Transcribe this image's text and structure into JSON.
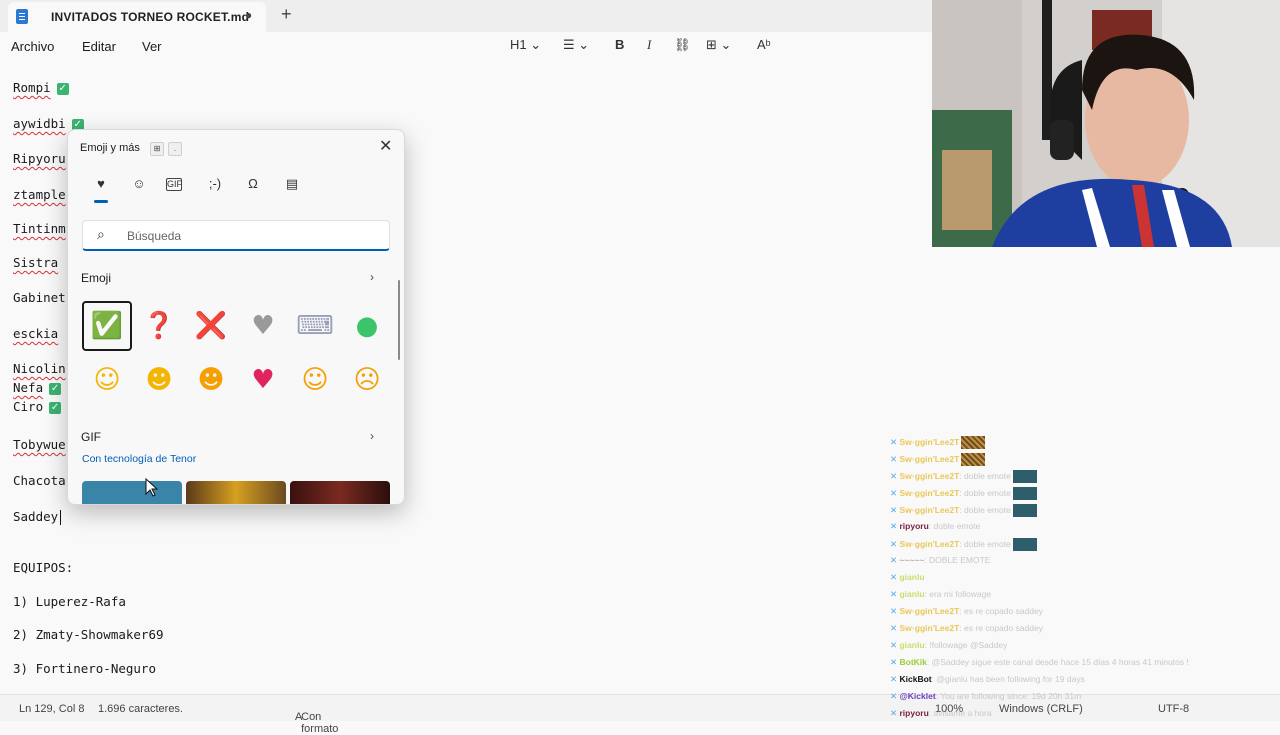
{
  "window": {
    "tab_title": "INVITADOS TORNEO ROCKET.md",
    "unsaved_indicator": "●",
    "new_tab": "+"
  },
  "menu": {
    "archivo": "Archivo",
    "editar": "Editar",
    "ver": "Ver"
  },
  "toolbar": {
    "heading": "H1",
    "bold": "B",
    "italic": "I"
  },
  "editor": {
    "lines": [
      {
        "text": "Rompi",
        "check": true
      },
      {
        "text": "aywidbi",
        "check": true
      },
      {
        "text": "Ripyoru",
        "check": false
      },
      {
        "text": "ztample",
        "check": false
      },
      {
        "text": "Tintinm",
        "check": false
      },
      {
        "text": "Sistra",
        "check": false
      },
      {
        "text": "Gabinet",
        "check": false
      },
      {
        "text": "esckia",
        "check": false
      },
      {
        "text": "Nicolin",
        "check": false
      },
      {
        "text": "Nefa",
        "check": true
      },
      {
        "text": "Ciro",
        "check": true
      },
      {
        "text": "Tobywue",
        "check": false
      },
      {
        "text": "Chacota",
        "check": false
      },
      {
        "text": "Saddey",
        "check": false
      },
      {
        "text": "EQUIPOS:",
        "check": false
      },
      {
        "text": "1) Luperez-Rafa",
        "check": false
      },
      {
        "text": "2) Zmaty-Showmaker69",
        "check": false
      },
      {
        "text": "3) Fortinero-Neguro",
        "check": false
      }
    ],
    "check_glyph": "✓"
  },
  "status_bar": {
    "position": "Ln 129, Col 8",
    "characters": "1.696 caracteres.",
    "format": "Con formato",
    "zoom": "100%",
    "line_endings": "Windows (CRLF)",
    "encoding": "UTF-8"
  },
  "emoji_panel": {
    "title": "Emoji y más",
    "close": "✕",
    "categories": [
      {
        "name": "favorites",
        "glyph": "♥"
      },
      {
        "name": "emoji",
        "glyph": "☺"
      },
      {
        "name": "gif",
        "glyph": "GIF"
      },
      {
        "name": "kaomoji",
        "glyph": ";-)"
      },
      {
        "name": "symbols",
        "glyph": "Ω"
      },
      {
        "name": "clipboard",
        "glyph": "▤"
      }
    ],
    "search_placeholder": "Búsqueda",
    "emoji_section": "Emoji",
    "gif_section": "GIF",
    "tenor_credit": "Con tecnología de Tenor",
    "emojis": [
      {
        "glyph": "✅",
        "color": "#3cb371",
        "selected": true
      },
      {
        "glyph": "❓",
        "color": "#d6336c"
      },
      {
        "glyph": "❌",
        "color": "#d6336c"
      },
      {
        "glyph": "♥",
        "color": "#9a9a9a"
      },
      {
        "glyph": "⌨",
        "color": "#9aa0b8"
      },
      {
        "glyph": "●",
        "color": "#3cc46a"
      },
      {
        "glyph": "☺",
        "color": "#f4b400"
      },
      {
        "glyph": "☻",
        "color": "#f4b400"
      },
      {
        "glyph": "☻",
        "color": "#f59f00"
      },
      {
        "glyph": "♥",
        "color": "#e0245e"
      },
      {
        "glyph": "☺",
        "color": "#f59f00"
      },
      {
        "glyph": "☹",
        "color": "#f59f00"
      }
    ]
  },
  "chat": {
    "lines": [
      {
        "user": "Sw◦ggin'Lee2T",
        "msg": "",
        "emote": "leo",
        "user_color": "#e8c85a"
      },
      {
        "user": "Sw◦ggin'Lee2T",
        "msg": "",
        "emote": "leo",
        "user_color": "#e8c85a"
      },
      {
        "user": "Sw◦ggin'Lee2T",
        "msg": ": doble emote",
        "emote": "teal",
        "user_color": "#e8c85a"
      },
      {
        "user": "Sw◦ggin'Lee2T",
        "msg": ": doble emote",
        "emote": "teal",
        "user_color": "#e8c85a"
      },
      {
        "user": "Sw◦ggin'Lee2T",
        "msg": ": doble emote",
        "emote": "teal",
        "user_color": "#e8c85a"
      },
      {
        "user": "ripyoru",
        "msg": ": doble emote",
        "emote": "",
        "user_color": "#7a1e3a"
      },
      {
        "user": "Sw◦ggin'Lee2T",
        "msg": ": doble emote",
        "emote": "teal",
        "user_color": "#e8c85a"
      },
      {
        "user": "~~~~~",
        "msg": ": DOBLE EMOTE",
        "emote": "",
        "user_color": "#c8a8a8"
      },
      {
        "user": "gianlu",
        "msg": "",
        "emote": "",
        "user_color": "#c8e070"
      },
      {
        "user": "gianlu",
        "msg": ": era mi followage",
        "emote": "",
        "user_color": "#c8e070"
      },
      {
        "user": "Sw◦ggin'Lee2T",
        "msg": ": es re copado saddey",
        "emote": "",
        "user_color": "#e8c85a"
      },
      {
        "user": "Sw◦ggin'Lee2T",
        "msg": ": es re copado saddey",
        "emote": "",
        "user_color": "#e8c85a"
      },
      {
        "user": "gianlu",
        "msg": ": !followage @Saddey",
        "emote": "",
        "user_color": "#c8e070"
      },
      {
        "user": "BotKik",
        "msg": ": @Saddey sigue este canal desde hace 15 días 4 horas 41 minutos !",
        "emote": "",
        "user_color": "#9acd32"
      },
      {
        "user": "KickBot",
        "msg": ": @gianlu has been following for 19 days",
        "emote": "",
        "user_color": "#111111"
      },
      {
        "user": "@Kicklet",
        "msg": ": You are following since: 19d 20h 31m",
        "emote": "",
        "user_color": "#6a3fbf"
      },
      {
        "user": "ripyoru",
        "msg": ": avisame a hora",
        "emote": "",
        "user_color": "#7a1e3a"
      }
    ]
  }
}
